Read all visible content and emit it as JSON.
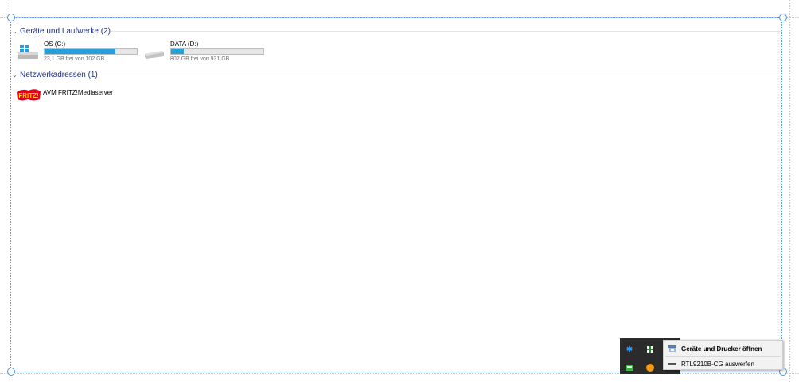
{
  "groups": {
    "devices": {
      "title": "Geräte und Laufwerke (2)"
    },
    "network": {
      "title": "Netzwerkadressen (1)"
    }
  },
  "drives": [
    {
      "name": "OS (C:)",
      "free_text": "23,1 GB frei von 102 GB",
      "used_fraction": 0.77,
      "icon": "windows-drive-icon"
    },
    {
      "name": "DATA (D:)",
      "free_text": "802 GB frei von 931 GB",
      "used_fraction": 0.14,
      "icon": "hard-drive-icon"
    }
  ],
  "network_items": [
    {
      "name": "AVM FRITZ!Mediaserver",
      "icon": "fritz-logo-icon"
    }
  ],
  "context_menu": {
    "items": [
      {
        "label": "Geräte und Drucker öffnen",
        "bold": true,
        "icon": "devices-printers-icon"
      },
      {
        "label": "RTL9210B-CG auswerfen",
        "bold": false,
        "icon": "eject-drive-icon"
      }
    ]
  },
  "tray_icons": [
    "bluetooth-icon",
    "shield-icon",
    "network-icon",
    "notification-icon"
  ],
  "colors": {
    "header": "#1e3287",
    "bar_fill": "#26a0da",
    "tray_bg": "#2b2b2b",
    "menu_bg": "#f2f2f2",
    "handle": "#4a90d9"
  }
}
